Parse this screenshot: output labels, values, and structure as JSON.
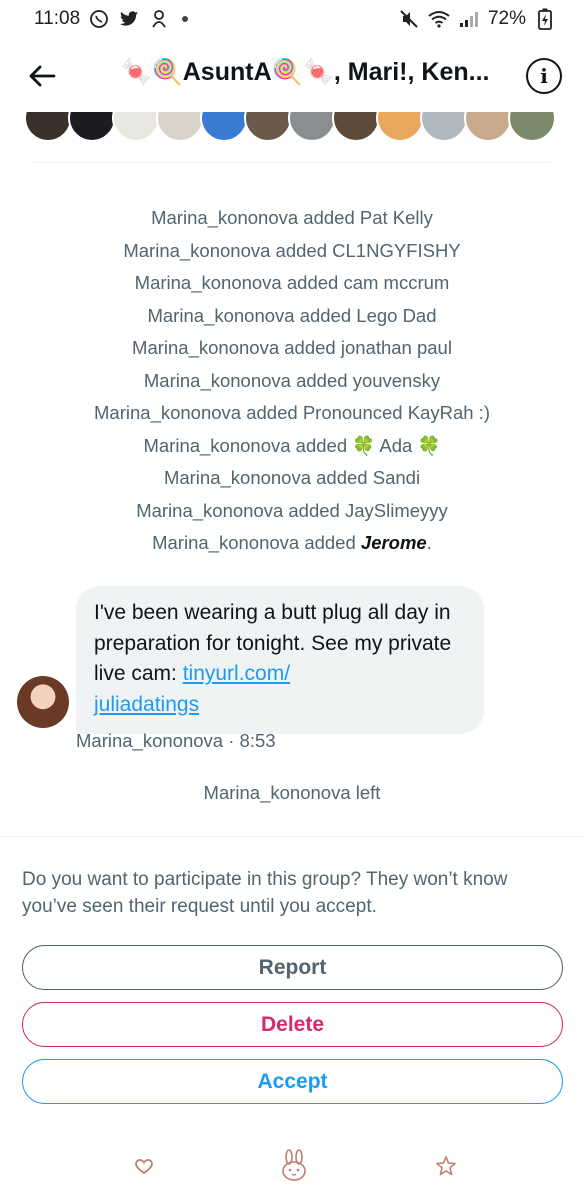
{
  "status_bar": {
    "time": "11:08",
    "battery": "72%"
  },
  "header": {
    "title": "🍬🍭AsuntA🍭🍬, Mari!, Ken...",
    "back_icon": "arrow-left-icon",
    "info_icon": "info-icon"
  },
  "system_messages": [
    {
      "prefix": "Marina_kononova added ",
      "name": "Pat Kelly"
    },
    {
      "prefix": "Marina_kononova added ",
      "name": "CL1NGYFISHY"
    },
    {
      "prefix": "Marina_kononova added ",
      "name": "cam mccrum"
    },
    {
      "prefix": "Marina_kononova added ",
      "name": "Lego Dad"
    },
    {
      "prefix": "Marina_kononova added ",
      "name": "jonathan paul"
    },
    {
      "prefix": "Marina_kononova added ",
      "name": "youvensky"
    },
    {
      "prefix": "Marina_kononova added ",
      "name": "Pronounced KayRah :)"
    },
    {
      "prefix": "Marina_kononova added ",
      "name": "🍀 Ada 🍀"
    },
    {
      "prefix": "Marina_kononova added ",
      "name": "Sandi"
    },
    {
      "prefix": "Marina_kononova added ",
      "name": "JaySlimeyyy"
    }
  ],
  "last_added": {
    "prefix": "Marina_kononova added ",
    "name": "Jerome",
    "suffix": "."
  },
  "message": {
    "text": "I've been wearing a butt plug all day in preparation for tonight. See my private live cam: ",
    "link_line1": "tinyurl.com/",
    "link_line2": "juliadatings",
    "sender": "Marina_kononova",
    "separator": " · ",
    "time": "8:53"
  },
  "left_notice": "Marina_kononova left",
  "request": {
    "prompt": "Do you want to participate in this group? They won’t know you’ve seen their request until you accept.",
    "report_label": "Report",
    "delete_label": "Delete",
    "accept_label": "Accept"
  },
  "colors": {
    "accent": "#1d9bf0",
    "danger": "#d6296b",
    "muted": "#536471"
  }
}
